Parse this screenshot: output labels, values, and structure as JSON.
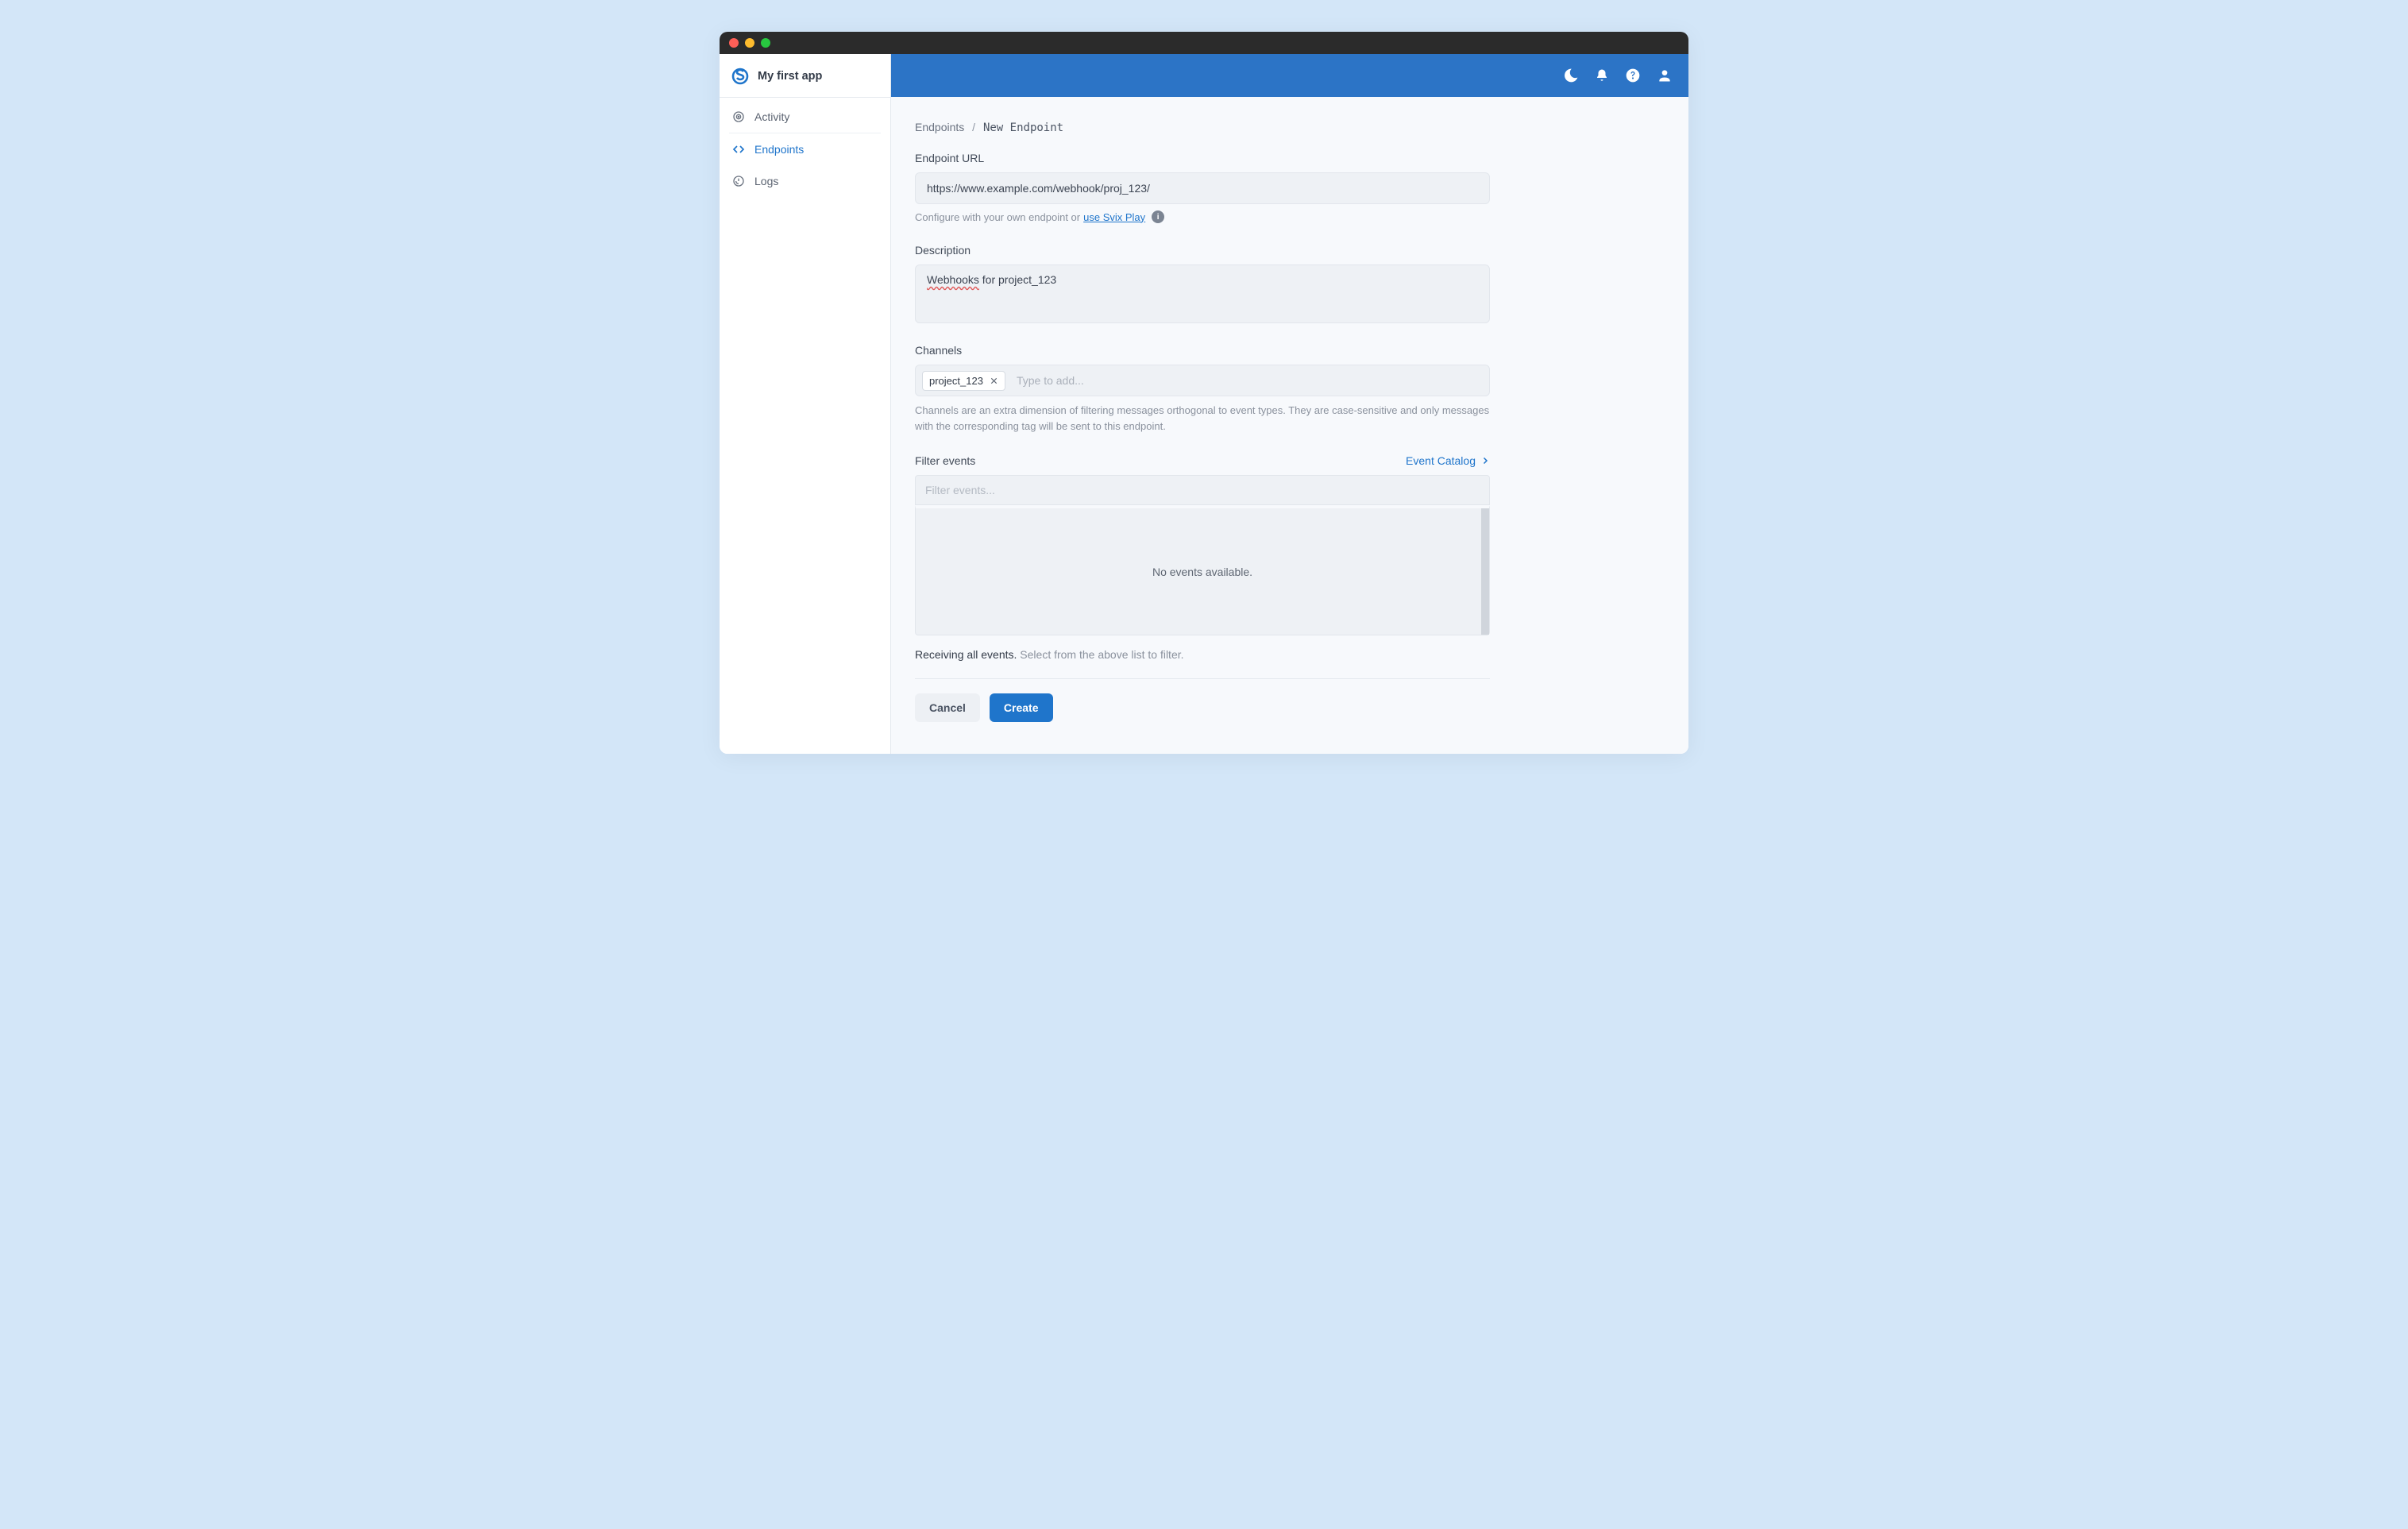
{
  "colors": {
    "accent": "#1f75cb",
    "topbar": "#2c74c6",
    "page_bg": "#d3e6f8"
  },
  "header": {
    "app_name": "My first app"
  },
  "sidebar": {
    "items": [
      {
        "label": "Activity"
      },
      {
        "label": "Endpoints"
      },
      {
        "label": "Logs"
      }
    ]
  },
  "breadcrumb": {
    "parent": "Endpoints",
    "separator": "/",
    "current": "New Endpoint"
  },
  "form": {
    "url_label": "Endpoint URL",
    "url_value": "https://www.example.com/webhook/proj_123/",
    "url_helper_prefix": "Configure with your own endpoint or ",
    "url_helper_link": "use Svix Play",
    "description_label": "Description",
    "description_word": "Webhooks",
    "description_rest": " for project_123",
    "channels_label": "Channels",
    "channels_chip": "project_123",
    "channels_placeholder": "Type to add...",
    "channels_helper": "Channels are an extra dimension of filtering messages orthogonal to event types. They are case-sensitive and only messages with the corresponding tag will be sent to this endpoint.",
    "filter_label": "Filter events",
    "catalog_link": "Event Catalog",
    "filter_placeholder": "Filter events...",
    "no_events": "No events available.",
    "receiving_strong": "Receiving all events.",
    "receiving_muted": "Select from the above list to filter."
  },
  "actions": {
    "cancel": "Cancel",
    "create": "Create"
  }
}
